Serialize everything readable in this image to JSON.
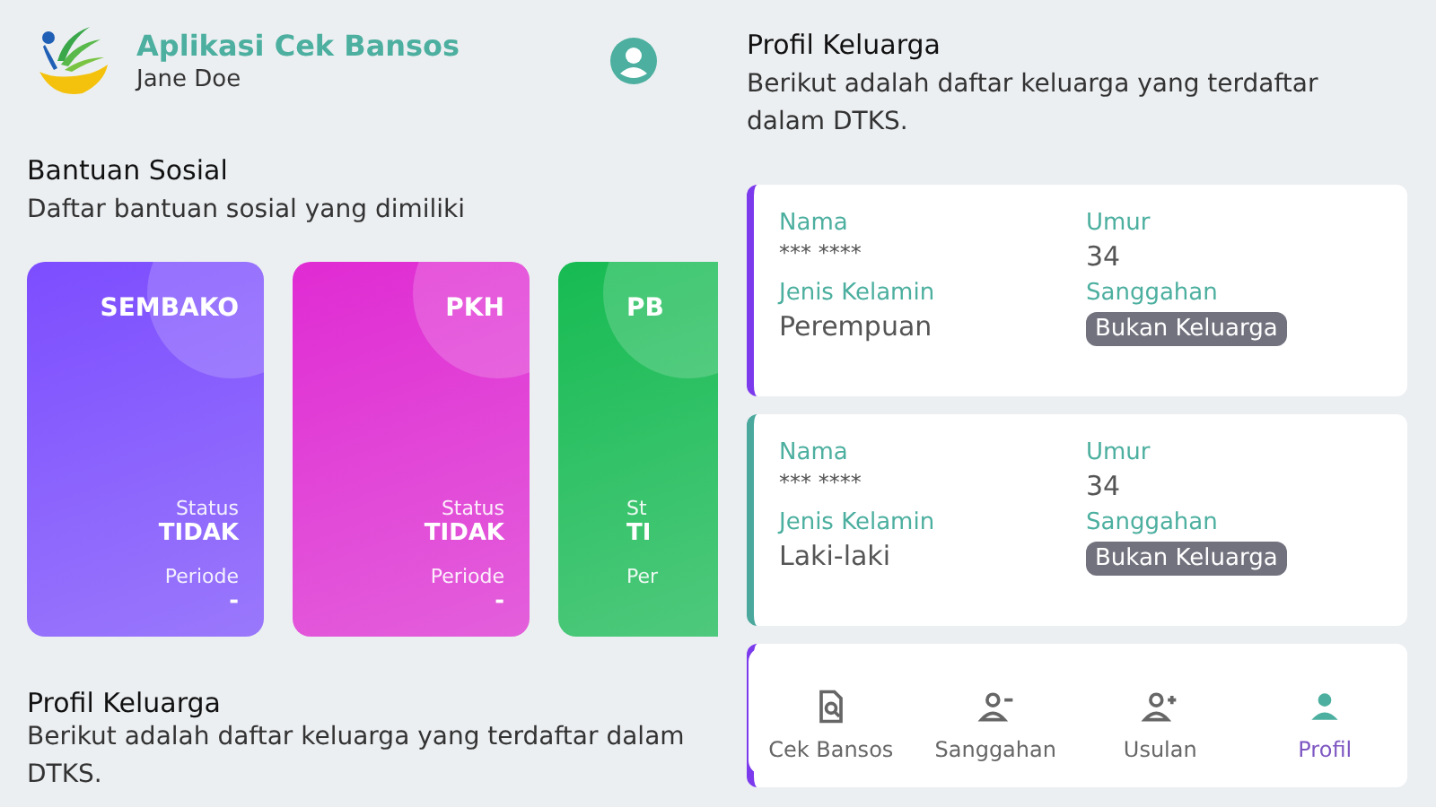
{
  "home": {
    "app_title": "Aplikasi Cek Bansos",
    "user_name": "Jane Doe",
    "bansos_section": {
      "title": "Bantuan Sosial",
      "description": "Daftar bantuan sosial yang dimiliki"
    },
    "bansos_cards": [
      {
        "kind": "full",
        "name": "SEMBAKO",
        "color": "#7c4dff",
        "status_label": "Status",
        "status": "TIDAK",
        "period_label": "Periode",
        "period": "-"
      },
      {
        "kind": "full",
        "name": "PKH",
        "color": "#e02bd3",
        "status_label": "Status",
        "status": "TIDAK",
        "period_label": "Periode",
        "period": "-"
      },
      {
        "kind": "partial",
        "name": "PB",
        "color": "#16bb52",
        "status_label": "St",
        "status": "TI",
        "period_label": "Per"
      }
    ],
    "family_section": {
      "title": "Profil Keluarga",
      "description": "Berikut adalah daftar keluarga yang terdaftar dalam DTKS."
    }
  },
  "profile": {
    "title": "Profil Keluarga",
    "description": "Berikut adalah daftar keluarga yang terdaftar dalam DTKS.",
    "members": [
      {
        "color": "#7c3aed",
        "name_label": "Nama",
        "name": "*** ****",
        "age_label": "Umur",
        "age": "34",
        "gender_label": "Jenis Kelamin",
        "gender": "Perempuan",
        "objection_label": "Sanggahan",
        "objection": "Bukan Keluarga"
      },
      {
        "color": "#4aa89c",
        "name_label": "Nama",
        "name": "*** ****",
        "age_label": "Umur",
        "age": "34",
        "gender_label": "Jenis Kelamin",
        "gender": "Laki-laki",
        "objection_label": "Sanggahan",
        "objection": "Bukan Keluarga"
      },
      {
        "color": "#7c3aed"
      }
    ],
    "nav": [
      {
        "kind": "search-doc",
        "label": "Cek Bansos",
        "selected": false
      },
      {
        "kind": "user-minus",
        "label": "Sanggahan",
        "selected": false
      },
      {
        "kind": "user-plus",
        "label": "Usulan",
        "selected": false
      },
      {
        "kind": "user",
        "label": "Profil",
        "selected": true
      }
    ]
  }
}
